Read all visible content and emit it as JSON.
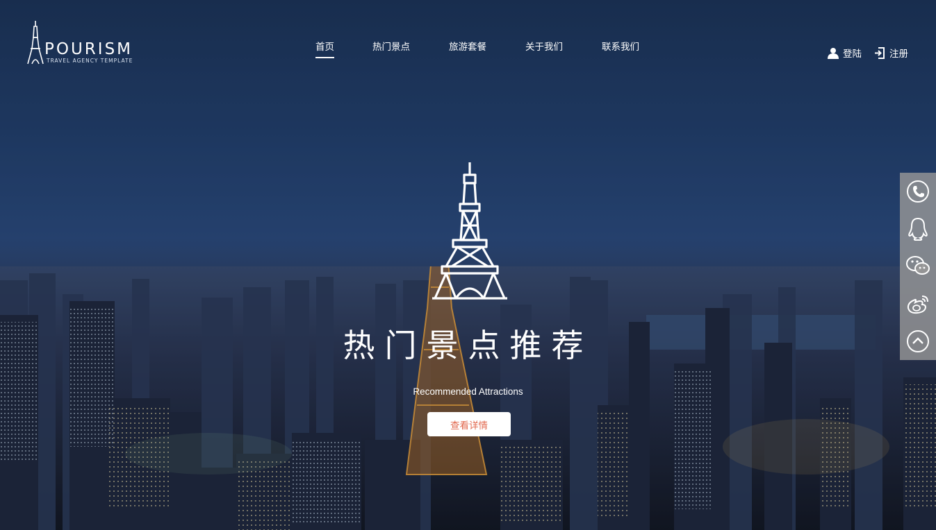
{
  "logo": {
    "name": "POURISM",
    "tagline": "TRAVEL AGENCY TEMPLATE"
  },
  "nav": {
    "items": [
      {
        "label": "首页",
        "active": true
      },
      {
        "label": "热门景点",
        "active": false
      },
      {
        "label": "旅游套餐",
        "active": false
      },
      {
        "label": "关于我们",
        "active": false
      },
      {
        "label": "联系我们",
        "active": false
      }
    ]
  },
  "auth": {
    "login": "登陆",
    "register": "注册"
  },
  "hero": {
    "title": "热门景点推荐",
    "subtitle": "Recommended Attractions",
    "button": "查看详情"
  },
  "sidebar": {
    "icons": [
      "phone-icon",
      "qq-icon",
      "wechat-icon",
      "weibo-icon",
      "back-to-top-icon"
    ]
  },
  "colors": {
    "accent_button_text": "#e2694f",
    "sidebar_bg": "#969696"
  }
}
